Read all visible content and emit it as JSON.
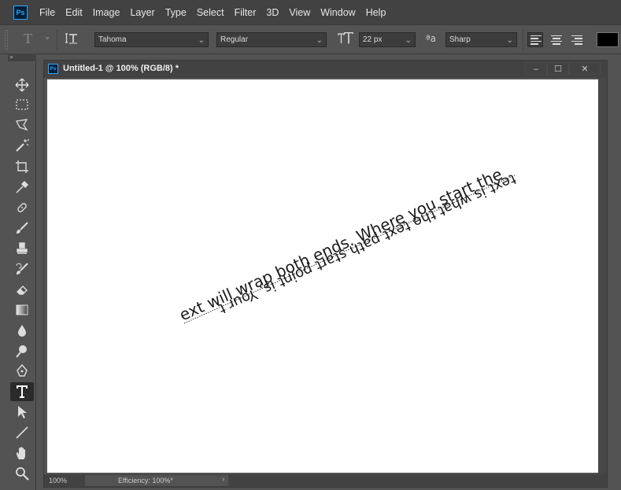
{
  "app": {
    "logo": "Ps"
  },
  "menu": [
    "File",
    "Edit",
    "Image",
    "Layer",
    "Type",
    "Select",
    "Filter",
    "3D",
    "View",
    "Window",
    "Help"
  ],
  "options": {
    "tool_icon": "T",
    "font_family": "Tahoma",
    "font_style": "Regular",
    "font_size": "22 px",
    "aa_label": "ªa",
    "antialias": "Sharp",
    "text_color": "#000000"
  },
  "toolbar": {
    "collapse": "»"
  },
  "document": {
    "title": "Untitled-1 @ 100% (RGB/8) *",
    "zoom": "100%",
    "efficiency": "Efficiency: 100%*",
    "window_buttons": [
      "‒",
      "☐",
      "✕"
    ]
  },
  "canvas_text": {
    "upper": "ext will wrap both ends.   Where you start the",
    "lower": "text is what the text path start point is.   Your t"
  },
  "colors": {
    "accent": "#31a8ff",
    "menubar": "#424242",
    "panel": "#535353"
  }
}
